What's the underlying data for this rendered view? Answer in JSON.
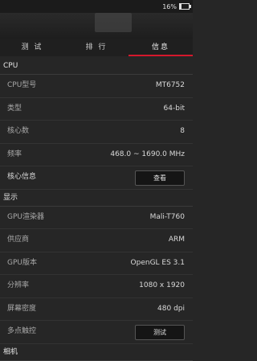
{
  "status": {
    "battery": "16%"
  },
  "tabs": [
    "测 试",
    "排 行",
    "信息"
  ],
  "sections": {
    "cpu": {
      "title": "CPU",
      "rows": [
        {
          "label": "CPU型号",
          "value": "MT6752"
        },
        {
          "label": "类型",
          "value": "64-bit"
        },
        {
          "label": "核心数",
          "value": "8"
        },
        {
          "label": "频率",
          "value": "468.0 ~ 1690.0 MHz"
        },
        {
          "label": "核心信息",
          "button": "查看"
        }
      ]
    },
    "display": {
      "title": "显示",
      "rows": [
        {
          "label": "GPU渲染器",
          "value": "Mali-T760"
        },
        {
          "label": "供应商",
          "value": "ARM"
        },
        {
          "label": "GPU版本",
          "value": "OpenGL ES 3.1"
        },
        {
          "label": "分辨率",
          "value": "1080 x 1920"
        },
        {
          "label": "屏幕密度",
          "value": "480 dpi"
        },
        {
          "label": "多点触控",
          "button": "测试"
        }
      ]
    },
    "camera": {
      "title": "相机"
    }
  }
}
